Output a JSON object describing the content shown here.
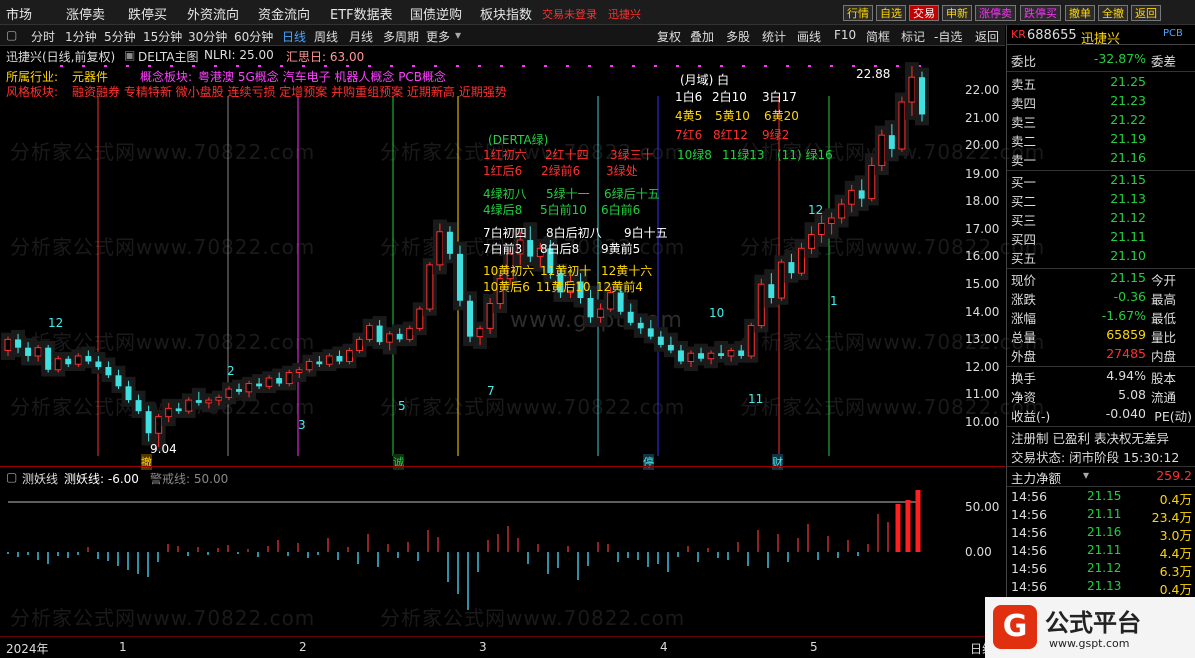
{
  "menubar": {
    "items": [
      "市场",
      "涨停卖",
      "跌停买",
      "外资流向",
      "资金流向",
      "ETF数据表",
      "国债逆购",
      "板块指数"
    ],
    "login_status": "交易未登录",
    "stock_name": "迅捷兴",
    "right_buttons": [
      "行情",
      "自选",
      "交易",
      "申新",
      "涨停卖",
      "跌停买",
      "撤单",
      "全撤",
      "返回"
    ]
  },
  "toolbar": {
    "periods": [
      "分时",
      "1分钟",
      "5分钟",
      "15分钟",
      "30分钟",
      "60分钟",
      "日线",
      "周线",
      "月线",
      "多周期",
      "更多"
    ],
    "active_period": "日线",
    "tools": [
      "复权",
      "叠加",
      "多股",
      "统计",
      "画线",
      "F10",
      "简框",
      "标记",
      "-自选",
      "返回"
    ]
  },
  "chart": {
    "header_stock": "迅捷兴(日线,前复权)",
    "indicator": "DELTA主图",
    "nlri": "NLRI: 25.00",
    "huisi": "汇思日: 63.00",
    "industry_label": "所属行业:",
    "industry_value": "元器件",
    "concept_label": "概念板块:",
    "concepts": "粤港澳  5G概念  汽车电子  机器人概念  PCB概念",
    "style_label": "风格板块:",
    "styles": "融资融券  专精特新  微小盘股  连续亏损  定增预案  并购重组预案  近期新高  近期强势",
    "high_price": "22.88",
    "low_price": "9.04",
    "y_ticks": [
      "22.00",
      "21.00",
      "20.00",
      "19.00",
      "18.00",
      "17.00",
      "16.00",
      "15.00",
      "14.00",
      "13.00",
      "12.00",
      "11.00",
      "10.00"
    ],
    "day_counts": [
      "12",
      "2",
      "3",
      "5",
      "7",
      "10",
      "11",
      "12",
      "1"
    ],
    "bottom_markers": [
      "撤",
      "诚",
      "停",
      "财"
    ]
  },
  "annotations": {
    "month_title": "(月域)  白",
    "row1": [
      "1白6",
      "2白10",
      "3白17"
    ],
    "row2": [
      "4黄5",
      "5黄10",
      "6黄20"
    ],
    "row3": [
      "7红6",
      "8红12",
      "9绿2"
    ],
    "row4": [
      "10绿8",
      "11绿13",
      "(11)  绿16"
    ],
    "derta_title": "(DERTA绿)",
    "d_red1": [
      "1红初六",
      "2红十四",
      "3绿三十"
    ],
    "d_red2": [
      "1红后6",
      "2绿前6",
      "3绿处"
    ],
    "d_green1": [
      "4绿初八",
      "5绿十一",
      "6绿后十五"
    ],
    "d_green2": [
      "4绿后8",
      "5白前10",
      "6白前6"
    ],
    "d_white1": [
      "7白初四",
      "8白后初八",
      "9白十五"
    ],
    "d_white2": [
      "7白前3",
      "8白后8",
      "9黄前5"
    ],
    "d_yellow1": [
      "10黄初六",
      "11黄初十",
      "12黄十六"
    ],
    "d_yellow2": [
      "10黄后6",
      "11黄后10",
      "12黄前4"
    ]
  },
  "sub_chart": {
    "title": "测妖线",
    "value_text": "测妖线: -6.00",
    "warn_text": "警戒线: 50.00",
    "y_ticks": [
      "50.00",
      "0.00"
    ]
  },
  "x_axis": {
    "labels": [
      "2024年",
      "1",
      "2",
      "3",
      "4",
      "5"
    ],
    "right_label": "日线"
  },
  "quote": {
    "code": "688655",
    "name": "迅捷兴",
    "prefix": "KR",
    "tag": "PCB",
    "weibi_label": "委比",
    "weibi_value": "-32.87%",
    "weicha_label": "委差",
    "asks": [
      [
        "卖五",
        "21.25"
      ],
      [
        "卖四",
        "21.23"
      ],
      [
        "卖三",
        "21.22"
      ],
      [
        "卖二",
        "21.19"
      ],
      [
        "卖一",
        "21.16"
      ]
    ],
    "bids": [
      [
        "买一",
        "21.15"
      ],
      [
        "买二",
        "21.13"
      ],
      [
        "买三",
        "21.12"
      ],
      [
        "买四",
        "21.11"
      ],
      [
        "买五",
        "21.10"
      ]
    ],
    "stats": [
      [
        "现价",
        "21.15",
        "今开",
        ""
      ],
      [
        "涨跌",
        "-0.36",
        "最高",
        ""
      ],
      [
        "涨幅",
        "-1.67%",
        "最低",
        ""
      ],
      [
        "总量",
        "65859",
        "量比",
        ""
      ],
      [
        "外盘",
        "27485",
        "内盘",
        ""
      ],
      [
        "换手",
        "4.94%",
        "股本",
        ""
      ],
      [
        "净资",
        "5.08",
        "流通",
        ""
      ],
      [
        "收益(-)",
        "-0.040",
        "PE(动)",
        ""
      ]
    ],
    "flags": "注册制 已盈利 表决权无差异",
    "trade_status": "交易状态: 闭市阶段 15:30:12",
    "main_flow_label": "主力净额",
    "main_flow_value": "259.2",
    "ticks": [
      [
        "14:56",
        "21.15",
        "0.4万"
      ],
      [
        "14:56",
        "21.11",
        "23.4万"
      ],
      [
        "14:56",
        "21.16",
        "3.0万"
      ],
      [
        "14:56",
        "21.11",
        "4.4万"
      ],
      [
        "14:56",
        "21.12",
        "6.3万"
      ],
      [
        "14:56",
        "21.13",
        "0.4万"
      ]
    ]
  },
  "watermark": {
    "text": "分析家公式网www.70822.com",
    "gspt": "www.gspt.com",
    "logo_text": "公式平台",
    "logo_url": "www.gspt.com"
  },
  "colors": {
    "up": "#ff3030",
    "down": "#40e0e0",
    "accent": "#ffd700"
  },
  "candles": [
    [
      12.6,
      13.1,
      12.4,
      13.0
    ],
    [
      13.0,
      13.2,
      12.5,
      12.7
    ],
    [
      12.7,
      12.9,
      12.2,
      12.4
    ],
    [
      12.4,
      12.8,
      12.2,
      12.7
    ],
    [
      12.7,
      12.8,
      11.8,
      11.9
    ],
    [
      11.9,
      12.4,
      11.8,
      12.3
    ],
    [
      12.3,
      12.4,
      12.0,
      12.1
    ],
    [
      12.1,
      12.5,
      12.0,
      12.4
    ],
    [
      12.4,
      12.6,
      12.1,
      12.2
    ],
    [
      12.2,
      12.4,
      11.9,
      12.0
    ],
    [
      12.0,
      12.2,
      11.6,
      11.7
    ],
    [
      11.7,
      11.9,
      11.2,
      11.3
    ],
    [
      11.3,
      11.5,
      10.7,
      10.8
    ],
    [
      10.8,
      11.0,
      10.3,
      10.4
    ],
    [
      10.4,
      10.6,
      9.3,
      9.6
    ],
    [
      9.6,
      10.3,
      9.1,
      10.2
    ],
    [
      10.2,
      10.7,
      10.0,
      10.5
    ],
    [
      10.5,
      10.7,
      10.3,
      10.4
    ],
    [
      10.4,
      10.9,
      10.3,
      10.8
    ],
    [
      10.8,
      11.1,
      10.6,
      10.7
    ],
    [
      10.7,
      10.9,
      10.5,
      10.8
    ],
    [
      10.8,
      11.0,
      10.6,
      10.9
    ],
    [
      10.9,
      11.3,
      10.8,
      11.2
    ],
    [
      11.2,
      11.4,
      11.0,
      11.1
    ],
    [
      11.1,
      11.5,
      10.9,
      11.4
    ],
    [
      11.4,
      11.6,
      11.2,
      11.3
    ],
    [
      11.3,
      11.7,
      11.2,
      11.6
    ],
    [
      11.6,
      11.8,
      11.3,
      11.4
    ],
    [
      11.4,
      11.9,
      11.3,
      11.8
    ],
    [
      11.8,
      12.0,
      11.6,
      11.9
    ],
    [
      11.9,
      12.3,
      11.8,
      12.2
    ],
    [
      12.2,
      12.4,
      12.0,
      12.1
    ],
    [
      12.1,
      12.5,
      12.0,
      12.4
    ],
    [
      12.4,
      12.6,
      12.1,
      12.2
    ],
    [
      12.2,
      12.7,
      12.1,
      12.6
    ],
    [
      12.6,
      13.1,
      12.5,
      13.0
    ],
    [
      13.0,
      13.6,
      12.9,
      13.5
    ],
    [
      13.5,
      13.7,
      12.8,
      12.9
    ],
    [
      12.9,
      13.3,
      12.6,
      13.2
    ],
    [
      13.2,
      13.4,
      12.9,
      13.0
    ],
    [
      13.0,
      13.5,
      12.9,
      13.4
    ],
    [
      13.4,
      14.2,
      13.3,
      14.1
    ],
    [
      14.1,
      15.8,
      14.0,
      15.7
    ],
    [
      15.7,
      17.2,
      15.5,
      16.9
    ],
    [
      16.9,
      17.1,
      15.9,
      16.1
    ],
    [
      16.1,
      16.4,
      14.2,
      14.4
    ],
    [
      14.4,
      14.6,
      12.9,
      13.1
    ],
    [
      13.1,
      13.5,
      12.8,
      13.4
    ],
    [
      13.4,
      14.5,
      13.2,
      14.3
    ],
    [
      14.3,
      15.4,
      14.1,
      15.2
    ],
    [
      15.2,
      16.3,
      15.0,
      16.1
    ],
    [
      16.1,
      16.9,
      15.7,
      16.6
    ],
    [
      16.6,
      17.1,
      15.8,
      16.0
    ],
    [
      16.0,
      16.5,
      15.6,
      16.3
    ],
    [
      16.3,
      16.6,
      15.2,
      15.4
    ],
    [
      15.4,
      15.6,
      14.5,
      14.7
    ],
    [
      14.7,
      15.3,
      14.5,
      15.1
    ],
    [
      15.1,
      15.4,
      14.3,
      14.5
    ],
    [
      14.5,
      14.8,
      13.6,
      13.8
    ],
    [
      13.8,
      14.3,
      13.6,
      14.1
    ],
    [
      14.1,
      14.9,
      14.0,
      14.7
    ],
    [
      14.7,
      14.9,
      13.9,
      14.0
    ],
    [
      14.0,
      14.3,
      13.5,
      13.6
    ],
    [
      13.6,
      13.8,
      13.2,
      13.4
    ],
    [
      13.4,
      13.7,
      13.0,
      13.1
    ],
    [
      13.1,
      13.3,
      12.7,
      12.8
    ],
    [
      12.8,
      13.1,
      12.5,
      12.6
    ],
    [
      12.6,
      12.8,
      12.1,
      12.2
    ],
    [
      12.2,
      12.6,
      12.0,
      12.5
    ],
    [
      12.5,
      12.7,
      12.2,
      12.3
    ],
    [
      12.3,
      12.6,
      12.1,
      12.5
    ],
    [
      12.5,
      12.8,
      12.3,
      12.4
    ],
    [
      12.4,
      12.7,
      12.2,
      12.6
    ],
    [
      12.6,
      12.8,
      12.3,
      12.4
    ],
    [
      12.4,
      13.6,
      12.3,
      13.5
    ],
    [
      13.5,
      15.2,
      13.4,
      15.0
    ],
    [
      15.0,
      15.4,
      14.3,
      14.5
    ],
    [
      14.5,
      15.9,
      14.4,
      15.8
    ],
    [
      15.8,
      16.1,
      15.2,
      15.4
    ],
    [
      15.4,
      16.5,
      15.3,
      16.3
    ],
    [
      16.3,
      17.1,
      16.1,
      16.8
    ],
    [
      16.8,
      17.5,
      16.5,
      17.2
    ],
    [
      17.2,
      17.6,
      16.8,
      17.4
    ],
    [
      17.4,
      18.1,
      17.2,
      17.9
    ],
    [
      17.9,
      18.6,
      17.6,
      18.4
    ],
    [
      18.4,
      18.8,
      17.8,
      18.1
    ],
    [
      18.1,
      19.6,
      18.0,
      19.3
    ],
    [
      19.3,
      20.6,
      19.1,
      20.4
    ],
    [
      20.4,
      20.8,
      19.6,
      19.9
    ],
    [
      19.9,
      21.8,
      19.8,
      21.6
    ],
    [
      21.6,
      22.9,
      21.1,
      22.5
    ],
    [
      22.5,
      22.7,
      20.9,
      21.15
    ]
  ],
  "sub_bars": [
    -2,
    -5,
    -3,
    -8,
    -12,
    -4,
    -6,
    -3,
    5,
    -7,
    -9,
    -14,
    -18,
    -22,
    -25,
    -10,
    8,
    6,
    -4,
    5,
    -3,
    4,
    7,
    -2,
    3,
    -5,
    6,
    12,
    -4,
    9,
    -6,
    -3,
    14,
    -8,
    5,
    -12,
    18,
    -15,
    8,
    -6,
    10,
    -9,
    22,
    15,
    -30,
    -42,
    -58,
    -20,
    12,
    18,
    26,
    14,
    -12,
    8,
    -22,
    -16,
    6,
    -28,
    -14,
    10,
    8,
    -10,
    -6,
    -8,
    -15,
    -12,
    -20,
    -5,
    6,
    -10,
    4,
    -6,
    -8,
    10,
    -14,
    22,
    -16,
    18,
    -10,
    14,
    28,
    -8,
    16,
    -6,
    12,
    -4,
    8,
    38,
    30,
    48,
    52,
    62
  ]
}
